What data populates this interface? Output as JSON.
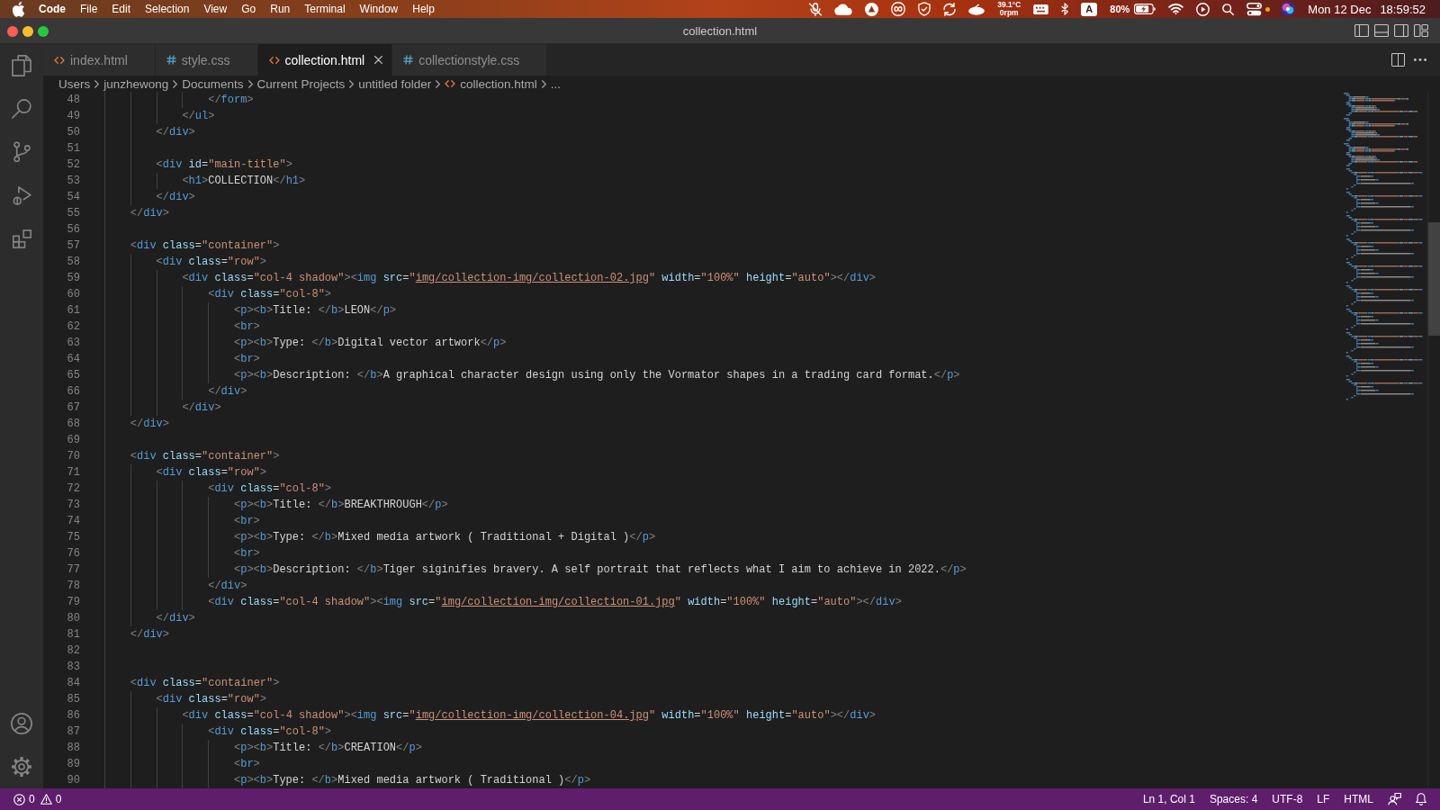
{
  "menu_bar": {
    "app_name": "Code",
    "menus": [
      "File",
      "Edit",
      "Selection",
      "View",
      "Go",
      "Run",
      "Terminal",
      "Window",
      "Help"
    ],
    "temperature": "39.1°C",
    "fan_speed": "0rpm",
    "input_source": "A",
    "battery": "80%",
    "date": "Mon 12 Dec",
    "time": "18:59:52"
  },
  "window": {
    "title": "collection.html"
  },
  "tabs": [
    {
      "label": "index.html",
      "kind": "html",
      "selected": false
    },
    {
      "label": "style.css",
      "kind": "css",
      "selected": false
    },
    {
      "label": "collection.html",
      "kind": "html",
      "selected": true
    },
    {
      "label": "collectionstyle.css",
      "kind": "css",
      "selected": false
    }
  ],
  "breadcrumb": {
    "path": [
      "Users",
      "junzhewong",
      "Documents",
      "Current Projects",
      "untitled folder"
    ],
    "file": {
      "label": "collection.html",
      "kind": "html"
    },
    "symbol": "..."
  },
  "editor": {
    "lines": [
      {
        "number": "48",
        "tokens": [
          {
            "kind": "punct",
            "text": "                </"
          },
          {
            "kind": "tag",
            "text": "form"
          },
          {
            "kind": "punct",
            "text": ">"
          }
        ]
      },
      {
        "number": "49",
        "tokens": [
          {
            "kind": "punct",
            "text": "            </"
          },
          {
            "kind": "tag",
            "text": "ul"
          },
          {
            "kind": "punct",
            "text": ">"
          }
        ]
      },
      {
        "number": "50",
        "tokens": [
          {
            "kind": "punct",
            "text": "        </"
          },
          {
            "kind": "tag",
            "text": "div"
          },
          {
            "kind": "punct",
            "text": ">"
          }
        ]
      },
      {
        "number": "51"
      },
      {
        "number": "52",
        "tokens": [
          {
            "kind": "punct",
            "text": "        <"
          },
          {
            "kind": "tag",
            "text": "div"
          },
          {
            "kind": "attr",
            "text": " id"
          },
          {
            "kind": "text",
            "text": "="
          },
          {
            "kind": "string",
            "text": "\"main-title\""
          },
          {
            "kind": "punct",
            "text": ">"
          }
        ]
      },
      {
        "number": "53",
        "tokens": [
          {
            "kind": "punct",
            "text": "            <"
          },
          {
            "kind": "tag",
            "text": "h1"
          },
          {
            "kind": "punct",
            "text": ">"
          },
          {
            "kind": "text",
            "text": "COLLECTION"
          },
          {
            "kind": "punct",
            "text": "</"
          },
          {
            "kind": "tag",
            "text": "h1"
          },
          {
            "kind": "punct",
            "text": ">"
          }
        ]
      },
      {
        "number": "54",
        "tokens": [
          {
            "kind": "punct",
            "text": "        </"
          },
          {
            "kind": "tag",
            "text": "div"
          },
          {
            "kind": "punct",
            "text": ">"
          }
        ]
      },
      {
        "number": "55",
        "tokens": [
          {
            "kind": "punct",
            "text": "    </"
          },
          {
            "kind": "tag",
            "text": "div"
          },
          {
            "kind": "punct",
            "text": ">"
          }
        ]
      },
      {
        "number": "56"
      },
      {
        "number": "57",
        "tokens": [
          {
            "kind": "punct",
            "text": "    <"
          },
          {
            "kind": "tag",
            "text": "div"
          },
          {
            "kind": "attr",
            "text": " class"
          },
          {
            "kind": "text",
            "text": "="
          },
          {
            "kind": "string",
            "text": "\"container\""
          },
          {
            "kind": "punct",
            "text": ">"
          }
        ]
      },
      {
        "number": "58",
        "tokens": [
          {
            "kind": "punct",
            "text": "        <"
          },
          {
            "kind": "tag",
            "text": "div"
          },
          {
            "kind": "attr",
            "text": " class"
          },
          {
            "kind": "text",
            "text": "="
          },
          {
            "kind": "string",
            "text": "\"row\""
          },
          {
            "kind": "punct",
            "text": ">"
          }
        ]
      },
      {
        "number": "59",
        "tokens": [
          {
            "kind": "punct",
            "text": "            <"
          },
          {
            "kind": "tag",
            "text": "div"
          },
          {
            "kind": "attr",
            "text": " class"
          },
          {
            "kind": "text",
            "text": "="
          },
          {
            "kind": "string",
            "text": "\"col-4 shadow\""
          },
          {
            "kind": "punct",
            "text": "><"
          },
          {
            "kind": "tag",
            "text": "img"
          },
          {
            "kind": "attr",
            "text": " src"
          },
          {
            "kind": "text",
            "text": "="
          },
          {
            "kind": "string",
            "text": "\""
          },
          {
            "kind": "link",
            "text": "img/collection-img/collection-02.jpg"
          },
          {
            "kind": "string",
            "text": "\""
          },
          {
            "kind": "attr",
            "text": " width"
          },
          {
            "kind": "text",
            "text": "="
          },
          {
            "kind": "string",
            "text": "\"100%\""
          },
          {
            "kind": "attr",
            "text": " height"
          },
          {
            "kind": "text",
            "text": "="
          },
          {
            "kind": "string",
            "text": "\"auto\""
          },
          {
            "kind": "punct",
            "text": "></"
          },
          {
            "kind": "tag",
            "text": "div"
          },
          {
            "kind": "punct",
            "text": ">"
          }
        ]
      },
      {
        "number": "60",
        "tokens": [
          {
            "kind": "punct",
            "text": "                <"
          },
          {
            "kind": "tag",
            "text": "div"
          },
          {
            "kind": "attr",
            "text": " class"
          },
          {
            "kind": "text",
            "text": "="
          },
          {
            "kind": "string",
            "text": "\"col-8\""
          },
          {
            "kind": "punct",
            "text": ">"
          }
        ]
      },
      {
        "number": "61",
        "tokens": [
          {
            "kind": "punct",
            "text": "                    <"
          },
          {
            "kind": "tag",
            "text": "p"
          },
          {
            "kind": "punct",
            "text": "><"
          },
          {
            "kind": "tag",
            "text": "b"
          },
          {
            "kind": "punct",
            "text": ">"
          },
          {
            "kind": "text",
            "text": "Title: "
          },
          {
            "kind": "punct",
            "text": "</"
          },
          {
            "kind": "tag",
            "text": "b"
          },
          {
            "kind": "punct",
            "text": ">"
          },
          {
            "kind": "text",
            "text": "LEON"
          },
          {
            "kind": "punct",
            "text": "</"
          },
          {
            "kind": "tag",
            "text": "p"
          },
          {
            "kind": "punct",
            "text": ">"
          }
        ]
      },
      {
        "number": "62",
        "tokens": [
          {
            "kind": "punct",
            "text": "                    <"
          },
          {
            "kind": "tag",
            "text": "br"
          },
          {
            "kind": "punct",
            "text": ">"
          }
        ]
      },
      {
        "number": "63",
        "tokens": [
          {
            "kind": "punct",
            "text": "                    <"
          },
          {
            "kind": "tag",
            "text": "p"
          },
          {
            "kind": "punct",
            "text": "><"
          },
          {
            "kind": "tag",
            "text": "b"
          },
          {
            "kind": "punct",
            "text": ">"
          },
          {
            "kind": "text",
            "text": "Type: "
          },
          {
            "kind": "punct",
            "text": "</"
          },
          {
            "kind": "tag",
            "text": "b"
          },
          {
            "kind": "punct",
            "text": ">"
          },
          {
            "kind": "text",
            "text": "Digital vector artwork"
          },
          {
            "kind": "punct",
            "text": "</"
          },
          {
            "kind": "tag",
            "text": "p"
          },
          {
            "kind": "punct",
            "text": ">"
          }
        ]
      },
      {
        "number": "64",
        "tokens": [
          {
            "kind": "punct",
            "text": "                    <"
          },
          {
            "kind": "tag",
            "text": "br"
          },
          {
            "kind": "punct",
            "text": ">"
          }
        ]
      },
      {
        "number": "65",
        "tokens": [
          {
            "kind": "punct",
            "text": "                    <"
          },
          {
            "kind": "tag",
            "text": "p"
          },
          {
            "kind": "punct",
            "text": "><"
          },
          {
            "kind": "tag",
            "text": "b"
          },
          {
            "kind": "punct",
            "text": ">"
          },
          {
            "kind": "text",
            "text": "Description: "
          },
          {
            "kind": "punct",
            "text": "</"
          },
          {
            "kind": "tag",
            "text": "b"
          },
          {
            "kind": "punct",
            "text": ">"
          },
          {
            "kind": "text",
            "text": "A graphical character design using only the Vormator shapes in a trading card format."
          },
          {
            "kind": "punct",
            "text": "</"
          },
          {
            "kind": "tag",
            "text": "p"
          },
          {
            "kind": "punct",
            "text": ">"
          }
        ]
      },
      {
        "number": "66",
        "tokens": [
          {
            "kind": "punct",
            "text": "                </"
          },
          {
            "kind": "tag",
            "text": "div"
          },
          {
            "kind": "punct",
            "text": ">"
          }
        ]
      },
      {
        "number": "67",
        "tokens": [
          {
            "kind": "punct",
            "text": "            </"
          },
          {
            "kind": "tag",
            "text": "div"
          },
          {
            "kind": "punct",
            "text": ">"
          }
        ]
      },
      {
        "number": "68",
        "tokens": [
          {
            "kind": "punct",
            "text": "    </"
          },
          {
            "kind": "tag",
            "text": "div"
          },
          {
            "kind": "punct",
            "text": ">"
          }
        ]
      },
      {
        "number": "69"
      },
      {
        "number": "70",
        "tokens": [
          {
            "kind": "punct",
            "text": "    <"
          },
          {
            "kind": "tag",
            "text": "div"
          },
          {
            "kind": "attr",
            "text": " class"
          },
          {
            "kind": "text",
            "text": "="
          },
          {
            "kind": "string",
            "text": "\"container\""
          },
          {
            "kind": "punct",
            "text": ">"
          }
        ]
      },
      {
        "number": "71",
        "tokens": [
          {
            "kind": "punct",
            "text": "        <"
          },
          {
            "kind": "tag",
            "text": "div"
          },
          {
            "kind": "attr",
            "text": " class"
          },
          {
            "kind": "text",
            "text": "="
          },
          {
            "kind": "string",
            "text": "\"row\""
          },
          {
            "kind": "punct",
            "text": ">"
          }
        ]
      },
      {
        "number": "72",
        "tokens": [
          {
            "kind": "punct",
            "text": "                <"
          },
          {
            "kind": "tag",
            "text": "div"
          },
          {
            "kind": "attr",
            "text": " class"
          },
          {
            "kind": "text",
            "text": "="
          },
          {
            "kind": "string",
            "text": "\"col-8\""
          },
          {
            "kind": "punct",
            "text": ">"
          }
        ]
      },
      {
        "number": "73",
        "tokens": [
          {
            "kind": "punct",
            "text": "                    <"
          },
          {
            "kind": "tag",
            "text": "p"
          },
          {
            "kind": "punct",
            "text": "><"
          },
          {
            "kind": "tag",
            "text": "b"
          },
          {
            "kind": "punct",
            "text": ">"
          },
          {
            "kind": "text",
            "text": "Title: "
          },
          {
            "kind": "punct",
            "text": "</"
          },
          {
            "kind": "tag",
            "text": "b"
          },
          {
            "kind": "punct",
            "text": ">"
          },
          {
            "kind": "text",
            "text": "BREAKTHROUGH"
          },
          {
            "kind": "punct",
            "text": "</"
          },
          {
            "kind": "tag",
            "text": "p"
          },
          {
            "kind": "punct",
            "text": ">"
          }
        ]
      },
      {
        "number": "74",
        "tokens": [
          {
            "kind": "punct",
            "text": "                    <"
          },
          {
            "kind": "tag",
            "text": "br"
          },
          {
            "kind": "punct",
            "text": ">"
          }
        ]
      },
      {
        "number": "75",
        "tokens": [
          {
            "kind": "punct",
            "text": "                    <"
          },
          {
            "kind": "tag",
            "text": "p"
          },
          {
            "kind": "punct",
            "text": "><"
          },
          {
            "kind": "tag",
            "text": "b"
          },
          {
            "kind": "punct",
            "text": ">"
          },
          {
            "kind": "text",
            "text": "Type: "
          },
          {
            "kind": "punct",
            "text": "</"
          },
          {
            "kind": "tag",
            "text": "b"
          },
          {
            "kind": "punct",
            "text": ">"
          },
          {
            "kind": "text",
            "text": "Mixed media artwork ( Traditional + Digital )"
          },
          {
            "kind": "punct",
            "text": "</"
          },
          {
            "kind": "tag",
            "text": "p"
          },
          {
            "kind": "punct",
            "text": ">"
          }
        ]
      },
      {
        "number": "76",
        "tokens": [
          {
            "kind": "punct",
            "text": "                    <"
          },
          {
            "kind": "tag",
            "text": "br"
          },
          {
            "kind": "punct",
            "text": ">"
          }
        ]
      },
      {
        "number": "77",
        "tokens": [
          {
            "kind": "punct",
            "text": "                    <"
          },
          {
            "kind": "tag",
            "text": "p"
          },
          {
            "kind": "punct",
            "text": "><"
          },
          {
            "kind": "tag",
            "text": "b"
          },
          {
            "kind": "punct",
            "text": ">"
          },
          {
            "kind": "text",
            "text": "Description: "
          },
          {
            "kind": "punct",
            "text": "</"
          },
          {
            "kind": "tag",
            "text": "b"
          },
          {
            "kind": "punct",
            "text": ">"
          },
          {
            "kind": "text",
            "text": "Tiger siginifies bravery. A self portrait that reflects what I aim to achieve in 2022."
          },
          {
            "kind": "punct",
            "text": "</"
          },
          {
            "kind": "tag",
            "text": "p"
          },
          {
            "kind": "punct",
            "text": ">"
          }
        ]
      },
      {
        "number": "78",
        "tokens": [
          {
            "kind": "punct",
            "text": "                </"
          },
          {
            "kind": "tag",
            "text": "div"
          },
          {
            "kind": "punct",
            "text": ">"
          }
        ]
      },
      {
        "number": "79",
        "tokens": [
          {
            "kind": "punct",
            "text": "                <"
          },
          {
            "kind": "tag",
            "text": "div"
          },
          {
            "kind": "attr",
            "text": " class"
          },
          {
            "kind": "text",
            "text": "="
          },
          {
            "kind": "string",
            "text": "\"col-4 shadow\""
          },
          {
            "kind": "punct",
            "text": "><"
          },
          {
            "kind": "tag",
            "text": "img"
          },
          {
            "kind": "attr",
            "text": " src"
          },
          {
            "kind": "text",
            "text": "="
          },
          {
            "kind": "string",
            "text": "\""
          },
          {
            "kind": "link",
            "text": "img/collection-img/collection-01.jpg"
          },
          {
            "kind": "string",
            "text": "\""
          },
          {
            "kind": "attr",
            "text": " width"
          },
          {
            "kind": "text",
            "text": "="
          },
          {
            "kind": "string",
            "text": "\"100%\""
          },
          {
            "kind": "attr",
            "text": " height"
          },
          {
            "kind": "text",
            "text": "="
          },
          {
            "kind": "string",
            "text": "\"auto\""
          },
          {
            "kind": "punct",
            "text": "></"
          },
          {
            "kind": "tag",
            "text": "div"
          },
          {
            "kind": "punct",
            "text": ">"
          }
        ]
      },
      {
        "number": "80",
        "tokens": [
          {
            "kind": "punct",
            "text": "        </"
          },
          {
            "kind": "tag",
            "text": "div"
          },
          {
            "kind": "punct",
            "text": ">"
          }
        ]
      },
      {
        "number": "81",
        "tokens": [
          {
            "kind": "punct",
            "text": "    </"
          },
          {
            "kind": "tag",
            "text": "div"
          },
          {
            "kind": "punct",
            "text": ">"
          }
        ]
      },
      {
        "number": "82"
      },
      {
        "number": "83"
      },
      {
        "number": "84",
        "tokens": [
          {
            "kind": "punct",
            "text": "    <"
          },
          {
            "kind": "tag",
            "text": "div"
          },
          {
            "kind": "attr",
            "text": " class"
          },
          {
            "kind": "text",
            "text": "="
          },
          {
            "kind": "string",
            "text": "\"container\""
          },
          {
            "kind": "punct",
            "text": ">"
          }
        ]
      },
      {
        "number": "85",
        "tokens": [
          {
            "kind": "punct",
            "text": "        <"
          },
          {
            "kind": "tag",
            "text": "div"
          },
          {
            "kind": "attr",
            "text": " class"
          },
          {
            "kind": "text",
            "text": "="
          },
          {
            "kind": "string",
            "text": "\"row\""
          },
          {
            "kind": "punct",
            "text": ">"
          }
        ]
      },
      {
        "number": "86",
        "tokens": [
          {
            "kind": "punct",
            "text": "            <"
          },
          {
            "kind": "tag",
            "text": "div"
          },
          {
            "kind": "attr",
            "text": " class"
          },
          {
            "kind": "text",
            "text": "="
          },
          {
            "kind": "string",
            "text": "\"col-4 shadow\""
          },
          {
            "kind": "punct",
            "text": "><"
          },
          {
            "kind": "tag",
            "text": "img"
          },
          {
            "kind": "attr",
            "text": " src"
          },
          {
            "kind": "text",
            "text": "="
          },
          {
            "kind": "string",
            "text": "\""
          },
          {
            "kind": "link",
            "text": "img/collection-img/collection-04.jpg"
          },
          {
            "kind": "string",
            "text": "\""
          },
          {
            "kind": "attr",
            "text": " width"
          },
          {
            "kind": "text",
            "text": "="
          },
          {
            "kind": "string",
            "text": "\"100%\""
          },
          {
            "kind": "attr",
            "text": " height"
          },
          {
            "kind": "text",
            "text": "="
          },
          {
            "kind": "string",
            "text": "\"auto\""
          },
          {
            "kind": "punct",
            "text": "></"
          },
          {
            "kind": "tag",
            "text": "div"
          },
          {
            "kind": "punct",
            "text": ">"
          }
        ]
      },
      {
        "number": "87",
        "tokens": [
          {
            "kind": "punct",
            "text": "                <"
          },
          {
            "kind": "tag",
            "text": "div"
          },
          {
            "kind": "attr",
            "text": " class"
          },
          {
            "kind": "text",
            "text": "="
          },
          {
            "kind": "string",
            "text": "\"col-8\""
          },
          {
            "kind": "punct",
            "text": ">"
          }
        ]
      },
      {
        "number": "88",
        "tokens": [
          {
            "kind": "punct",
            "text": "                    <"
          },
          {
            "kind": "tag",
            "text": "p"
          },
          {
            "kind": "punct",
            "text": "><"
          },
          {
            "kind": "tag",
            "text": "b"
          },
          {
            "kind": "punct",
            "text": ">"
          },
          {
            "kind": "text",
            "text": "Title: "
          },
          {
            "kind": "punct",
            "text": "</"
          },
          {
            "kind": "tag",
            "text": "b"
          },
          {
            "kind": "punct",
            "text": ">"
          },
          {
            "kind": "text",
            "text": "CREATION"
          },
          {
            "kind": "punct",
            "text": "</"
          },
          {
            "kind": "tag",
            "text": "p"
          },
          {
            "kind": "punct",
            "text": ">"
          }
        ]
      },
      {
        "number": "89",
        "tokens": [
          {
            "kind": "punct",
            "text": "                    <"
          },
          {
            "kind": "tag",
            "text": "br"
          },
          {
            "kind": "punct",
            "text": ">"
          }
        ]
      },
      {
        "number": "90",
        "tokens": [
          {
            "kind": "punct",
            "text": "                    <"
          },
          {
            "kind": "tag",
            "text": "p"
          },
          {
            "kind": "punct",
            "text": "><"
          },
          {
            "kind": "tag",
            "text": "b"
          },
          {
            "kind": "punct",
            "text": ">"
          },
          {
            "kind": "text",
            "text": "Type: "
          },
          {
            "kind": "punct",
            "text": "</"
          },
          {
            "kind": "tag",
            "text": "b"
          },
          {
            "kind": "punct",
            "text": ">"
          },
          {
            "kind": "text",
            "text": "Mixed media artwork ( Traditional )"
          },
          {
            "kind": "punct",
            "text": "</"
          },
          {
            "kind": "tag",
            "text": "p"
          },
          {
            "kind": "punct",
            "text": ">"
          }
        ]
      }
    ]
  },
  "status_bar": {
    "errors": "0",
    "warnings": "0",
    "items": [
      "Ln 1, Col 1",
      "Spaces: 4",
      "UTF-8",
      "LF",
      "HTML"
    ]
  }
}
